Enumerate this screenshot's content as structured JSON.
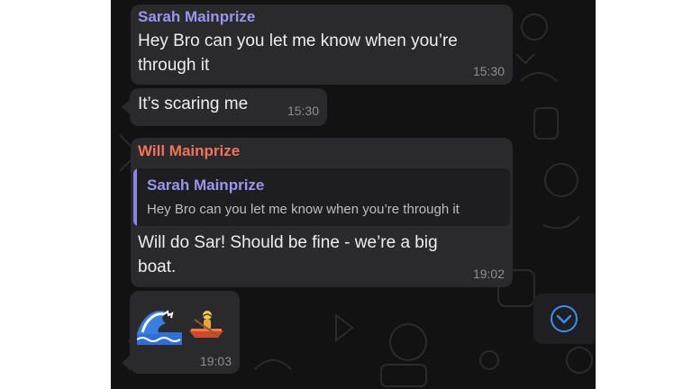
{
  "colors": {
    "chat_background": "#121212",
    "bubble": "#2a2a2c",
    "sender_sarah": "#9b95ee",
    "sender_will": "#f0735a",
    "timestamp": "#8d8d92",
    "scroll_button_icon": "#3b8ff0"
  },
  "messages": [
    {
      "sender": "Sarah Mainprize",
      "lines": [
        "Hey Bro can you let me know when you’re",
        "through it"
      ],
      "time": "15:30"
    },
    {
      "text": "It’s scaring me",
      "time": "15:30"
    },
    {
      "sender": "Will Mainprize",
      "reply_to": {
        "sender": "Sarah Mainprize",
        "text": "Hey Bro can you let me know when you’re through it"
      },
      "lines": [
        "Will do Sar! Should be fine - we’re a big",
        "boat."
      ],
      "time": "19:02"
    },
    {
      "emojis": [
        "water-wave-emoji",
        "person-rowing-boat-emoji"
      ],
      "time": "19:03"
    }
  ],
  "scroll_button": {
    "icon": "chevron-down-icon"
  }
}
